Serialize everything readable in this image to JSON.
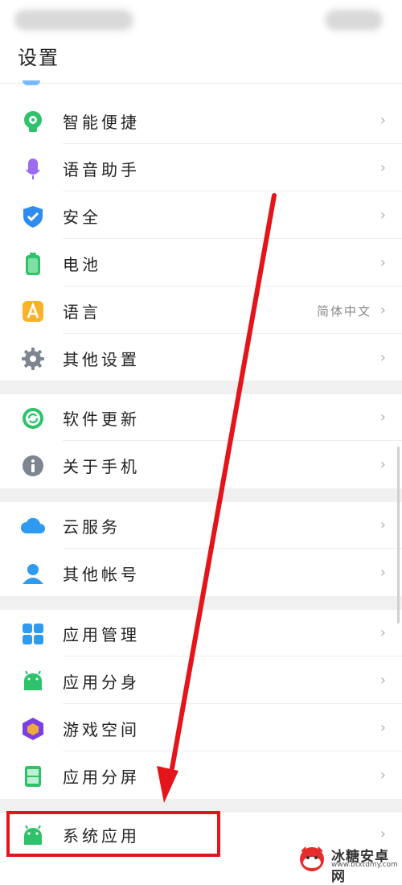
{
  "header": {
    "title": "设置"
  },
  "chevron": "›",
  "watermark": {
    "name": "冰糖安卓网",
    "url": "www.btxtdmy.com"
  },
  "annotation_color": "#e4141b",
  "sections": [
    {
      "items": [
        {
          "label": "智能便捷",
          "icon": "smart-assist-icon",
          "color": "#2ec26a"
        },
        {
          "label": "语音助手",
          "icon": "microphone-icon",
          "color": "#9b6cf0"
        },
        {
          "label": "安全",
          "icon": "shield-icon",
          "color": "#2e8cf0"
        },
        {
          "label": "电池",
          "icon": "battery-icon",
          "color": "#2ec26a"
        },
        {
          "label": "语言",
          "icon": "language-icon",
          "color": "#f7b32b",
          "value": "简体中文"
        },
        {
          "label": "其他设置",
          "icon": "gear-icon",
          "color": "#7d8590"
        }
      ]
    },
    {
      "items": [
        {
          "label": "软件更新",
          "icon": "update-icon",
          "color": "#2ec26a"
        },
        {
          "label": "关于手机",
          "icon": "info-icon",
          "color": "#7d8590"
        }
      ]
    },
    {
      "items": [
        {
          "label": "云服务",
          "icon": "cloud-icon",
          "color": "#2e9bf0"
        },
        {
          "label": "其他帐号",
          "icon": "account-icon",
          "color": "#2e9bf0"
        }
      ]
    },
    {
      "items": [
        {
          "label": "应用管理",
          "icon": "app-grid-icon",
          "color": "#2e9bf0"
        },
        {
          "label": "应用分身",
          "icon": "android-clone-icon",
          "color": "#2ec26a"
        },
        {
          "label": "游戏空间",
          "icon": "game-space-icon",
          "color": "#7b3fe4"
        },
        {
          "label": "应用分屏",
          "icon": "split-screen-icon",
          "color": "#2ec26a"
        }
      ]
    },
    {
      "items": [
        {
          "label": "系统应用",
          "icon": "android-icon",
          "color": "#2ec26a"
        }
      ]
    }
  ]
}
